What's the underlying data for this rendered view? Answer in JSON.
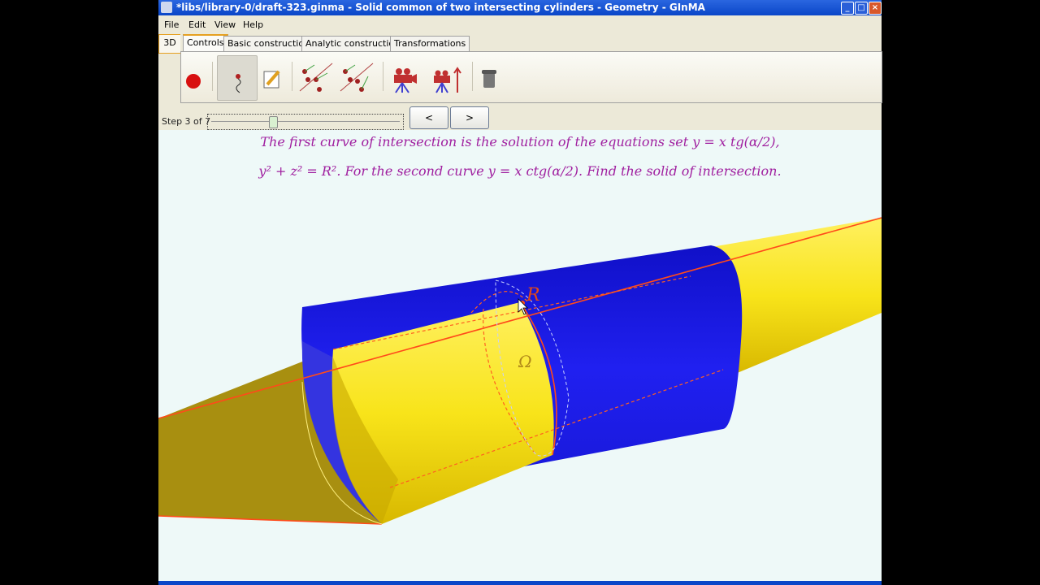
{
  "window": {
    "title": "*libs/library-0/draft-323.ginma - Solid common of two intersecting cylinders - Geometry - GInMA"
  },
  "menu": [
    "File",
    "Edit",
    "View",
    "Help"
  ],
  "tabs": {
    "side": "3D",
    "items": [
      "Controls",
      "Basic construction",
      "Analytic construction",
      "Transformations"
    ]
  },
  "toolbar": {
    "icons": [
      "record-icon",
      "free-move-icon",
      "edit-icon",
      "lines-points-icon",
      "lines-points-alt-icon",
      "camera-icon",
      "camera-up-icon",
      "trash-icon"
    ]
  },
  "steps": {
    "label": "Step 3 of 7",
    "current": 3,
    "total": 7,
    "prev": "<",
    "next": ">"
  },
  "problem": {
    "line1": "The first curve of intersection is the solution of the equations set y = x tg(α/2),",
    "line2": "y² + z² = R². For the second curve y = x ctg(α/2). Find the solid of intersection."
  },
  "scene": {
    "label_r": "R",
    "label_omega": "Ω"
  },
  "colors": {
    "blue": "#1a1ae8",
    "yellow": "#f8e61a",
    "curve": "#ff4a1a"
  }
}
